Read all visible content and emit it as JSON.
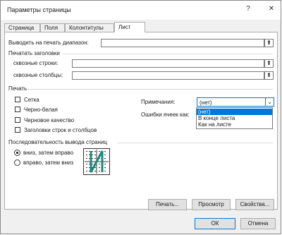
{
  "window": {
    "title": "Параметры страницы",
    "help": "?",
    "close": "✕"
  },
  "tabs": [
    {
      "label": "Страница"
    },
    {
      "label": "Поля"
    },
    {
      "label": "Колонтитулы"
    },
    {
      "label": "Лист"
    }
  ],
  "print_area": {
    "label": "Выводить на печать диапазон:",
    "value": "",
    "btn": "⬆"
  },
  "print_titles": {
    "group_label": "Печатать заголовки",
    "rows_label": "сквозные строки:",
    "cols_label": "сквозные столбцы:",
    "rows_value": "",
    "cols_value": "",
    "btn": "⬆"
  },
  "print": {
    "group_label": "Печать",
    "gridlines": {
      "label": "Сетка",
      "checked": false
    },
    "black_white": {
      "label": "Черно-белая",
      "checked": false
    },
    "draft": {
      "label": "Черновое качество",
      "checked": false
    },
    "headings": {
      "label": "Заголовки строк и столбцов",
      "checked": false
    },
    "comments_label": "Примечания:",
    "comments_value": "(нет)",
    "errors_label": "Ошибки ячеек как:",
    "comments_options": [
      "(нет)",
      "В конце листа",
      "Как на листе"
    ]
  },
  "page_order": {
    "group_label": "Последовательность вывода страниц",
    "down_then_over": "вниз, затем вправо",
    "over_then_down": "вправо, затем вниз",
    "selected": "down_then_over"
  },
  "buttons": {
    "print": "Печать...",
    "preview": "Просмотр",
    "options": "Свойства...",
    "ok": "ОК",
    "cancel": "Отмена"
  }
}
